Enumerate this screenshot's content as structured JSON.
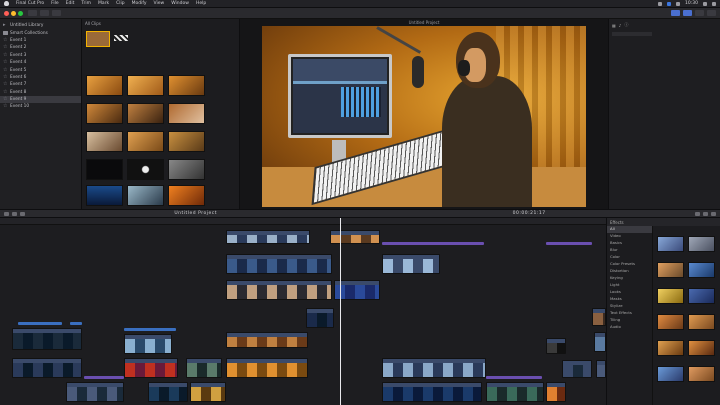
{
  "menubar": {
    "items": [
      "Final Cut Pro",
      "File",
      "Edit",
      "Trim",
      "Mark",
      "Clip",
      "Modify",
      "View",
      "Window",
      "Help"
    ],
    "clock": "10:30"
  },
  "libraries": {
    "items": [
      "Untitled Library",
      "Smart Collections",
      "Event 1",
      "Event 2",
      "Event 3",
      "Event 4",
      "Event 5",
      "Event 6",
      "Event 7",
      "Event 8",
      "Event 9",
      "Event 10"
    ],
    "selected_index": 10
  },
  "browser": {
    "filter_label": "All Clips"
  },
  "viewer": {
    "title": "Untitled Project"
  },
  "timeline": {
    "timecode": "00:00:21:17",
    "project_label": "Untitled Project"
  },
  "effects": {
    "header": "Effects",
    "categories": [
      "All",
      "Video",
      "Basics",
      "Blur",
      "Color",
      "Color Presets",
      "Distortion",
      "Keying",
      "Light",
      "Looks",
      "Masks",
      "Stylize",
      "Text Effects",
      "Tiling",
      "Audio"
    ],
    "selected_index": 0
  },
  "colors": {
    "selection_outline": "#f2b300",
    "clip_video": "#3a4a6a",
    "lane_purple": "#6a4fb0",
    "accent_blue": "#3b76e0"
  }
}
